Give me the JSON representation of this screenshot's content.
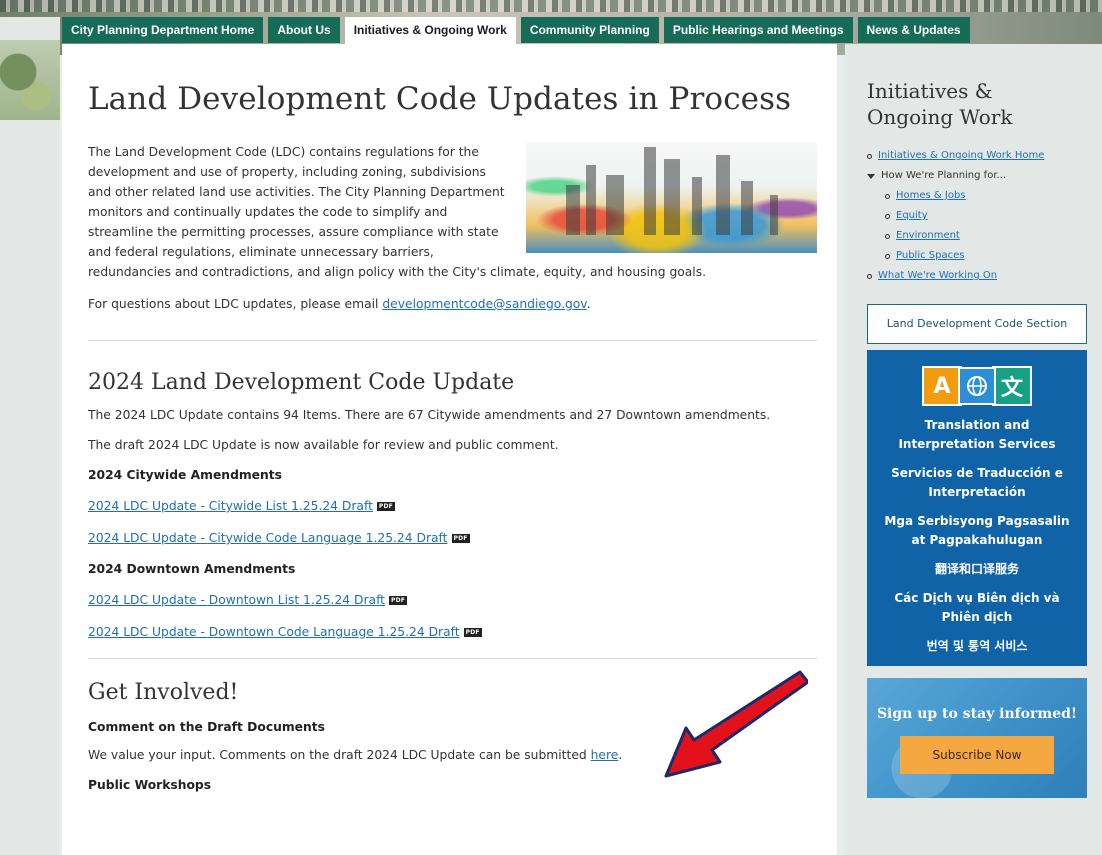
{
  "nav": {
    "tabs": [
      {
        "label": "City Planning Department Home"
      },
      {
        "label": "About Us"
      },
      {
        "label": "Initiatives & Ongoing Work"
      },
      {
        "label": "Community Planning"
      },
      {
        "label": "Public Hearings and Meetings"
      },
      {
        "label": "News & Updates"
      }
    ],
    "active": "Initiatives & Ongoing Work"
  },
  "main": {
    "title": "Land Development Code Updates in Process",
    "intro": "The Land Development Code (LDC) contains regulations for the development and use of property, including zoning, subdivisions and other related land use activities. The City Planning Department monitors and continually updates the code to simplify and streamline the permitting processes, assure compliance with state and federal regulations, eliminate unnecessary barriers, redundancies and contradictions, and align policy with the City's climate, equity, and housing goals.",
    "questions_prefix": "For questions about LDC updates, please email ",
    "email": "developmentcode@sandiego.gov",
    "questions_suffix": ".",
    "section2024": {
      "title": "2024 Land Development Code Update",
      "p1": "The 2024 LDC Update contains 94 Items. There are 67 Citywide amendments and 27 Downtown amendments.",
      "p2": "The draft 2024 LDC Update is now available for review and public comment.",
      "citywide_heading": "2024 Citywide Amendments",
      "citywide_links": [
        "2024 LDC Update - Citywide List 1.25.24 Draft",
        "2024 LDC Update - Citywide Code Language 1.25.24 Draft"
      ],
      "downtown_heading": "2024 Downtown Amendments",
      "downtown_links": [
        "2024 LDC Update - Downtown List 1.25.24 Draft",
        "2024 LDC Update - Downtown Code Language 1.25.24 Draft"
      ],
      "pdf_badge": "PDF"
    },
    "get_involved": {
      "title": "Get Involved!",
      "comment_heading": "Comment on the Draft Documents",
      "comment_text_prefix": "We value your input. Comments on the draft 2024 LDC Update can be submitted ",
      "comment_link": "here",
      "comment_text_suffix": ".",
      "workshops_heading": "Public Workshops"
    }
  },
  "sidebar": {
    "title_line1": "Initiatives &",
    "title_line2": "Ongoing Work",
    "items": [
      {
        "label": "Initiatives & Ongoing Work Home"
      },
      {
        "label": "How We're Planning for..."
      },
      {
        "label": "Homes & Jobs"
      },
      {
        "label": "Equity"
      },
      {
        "label": "Environment"
      },
      {
        "label": "Public Spaces"
      },
      {
        "label": "What We're Working On"
      }
    ],
    "ldc_button": "Land Development Code Section",
    "translation": {
      "icon_a": "A",
      "icon_w": "文",
      "lines": [
        "Translation and Interpretation Services",
        "Servicios de Traducción e Interpretación",
        "Mga Serbisyong Pagsasalin at Pagpakahulugan",
        "翻译和口译服务",
        "Các Dịch vụ Biên dịch và Phiên dịch",
        "번역 및 통역 서비스"
      ]
    },
    "signup": {
      "title": "Sign up to stay informed!",
      "button": "Subscribe Now"
    }
  },
  "colors": {
    "nav_green": "#176c58",
    "link": "#1f6fb2",
    "translate_bg": "#0f63a6",
    "subscribe_btn": "#f5a742",
    "arrow": "#e3111a"
  }
}
